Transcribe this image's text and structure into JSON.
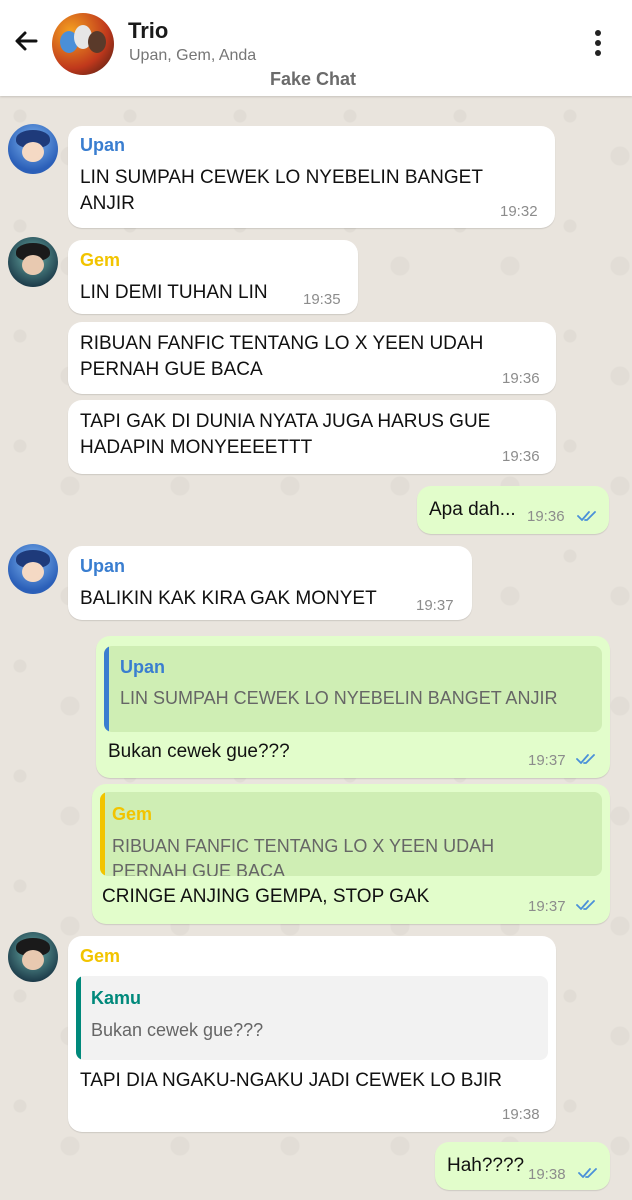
{
  "header": {
    "title": "Trio",
    "subtitle": "Upan, Gem, Anda",
    "tag": "Fake Chat"
  },
  "colors": {
    "upan": "#3a7ed0",
    "gem": "#f2c400",
    "kamu": "#00897b",
    "tick": "#4a90d9",
    "outgoing_bg": "#e2fdcb",
    "quote_bg_out": "#cfeeb4",
    "quote_bg_in": "#f2f2f2"
  },
  "messages": [
    {
      "sender": "Upan",
      "text1": "LIN SUMPAH CEWEK LO NYEBELIN BANGET",
      "text2": "ANJIR",
      "time": "19:32"
    },
    {
      "sender": "Gem",
      "text1": "LIN DEMI TUHAN LIN",
      "time": "19:35"
    },
    {
      "text1": "RIBUAN FANFIC TENTANG LO X YEEN UDAH",
      "text2": "PERNAH GUE BACA",
      "time": "19:36"
    },
    {
      "text1": "TAPI GAK DI DUNIA NYATA JUGA HARUS GUE",
      "text2": "HADAPIN MONYEEEETTT",
      "time": "19:36"
    },
    {
      "text1": "Apa dah...",
      "time": "19:36"
    },
    {
      "sender": "Upan",
      "text1": "BALIKIN KAK KIRA GAK MONYET",
      "time": "19:37"
    },
    {
      "quote_sender": "Upan",
      "quote_text": "LIN SUMPAH CEWEK LO NYEBELIN BANGET ANJIR",
      "text1": "Bukan cewek gue???",
      "time": "19:37"
    },
    {
      "quote_sender": "Gem",
      "quote_text1": "RIBUAN FANFIC TENTANG LO X YEEN UDAH",
      "quote_text2": "PERNAH GUE BACA",
      "text1": "CRINGE ANJING GEMPA, STOP GAK",
      "time": "19:37"
    },
    {
      "sender": "Gem",
      "quote_sender": "Kamu",
      "quote_text": "Bukan cewek gue???",
      "text1": "TAPI DIA NGAKU-NGAKU JADI CEWEK LO BJIR",
      "time": "19:38"
    },
    {
      "text1": "Hah????",
      "time": "19:38"
    }
  ]
}
